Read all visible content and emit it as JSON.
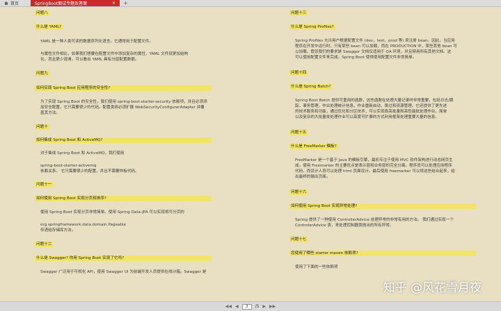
{
  "tabs": {
    "home": "首页",
    "active": "SpringBoot面试专题及答案",
    "close": "×",
    "add": "+"
  },
  "left": {
    "h8": "问题八",
    "q8": "什么是 YAML?",
    "p8a_1": "YAML 是一种人类可读的数据序列化语言。它通常用于配置文件。",
    "p8b_1": "与属性文件相比，如果我们想要在配置文件中添加复杂的属性，YAML 文件就更加结构",
    "p8b_2": "化，而且更少混淆。可以看出 YAML 具有分层配置数据。",
    "h9": "问题九",
    "q9": "如何实现 Spring Boot 应用程序的安全性?",
    "p9_1": "为了实现 Spring Boot 的安全性，我们使用 spring-boot-starter-security 依赖项，并且必须添",
    "p9_2": "加安全配置。它只需要很少的代码。配置类将必须扩展 WebSecurityConfigurerAdapter 并覆",
    "p9_3": "盖其方法。",
    "h10": "问题十",
    "q10": "如何集成 Spring Boot 和 ActiveMQ?",
    "p10a": "对于集成 Spring Boot 和 ActiveMQ，我们使用",
    "p10b": "spring-boot-starter-activemq",
    "p10c": "依赖关系。 它只需要很少的配置，并且不需要样板代码。",
    "h11": "问题十一",
    "q11": "如何使用 Spring Boot 实现分页和排序?",
    "p11a": "使用 Spring Boot 实现分页非常简单。使用 Spring Data-JPA 可以实现将可分页的",
    "p11b": "org.springframework.data.domain.Pageable",
    "p11c": "传递给存储库方法。",
    "h12": "问题十二",
    "q12": "什么是 Swagger? 你用 Spring Boot 实现了它吗?",
    "p12": "Swagger 广泛用于可视化 API，使用 Swagger UI 为前端开发人员提供在线沙箱。Swagger 是"
  },
  "right": {
    "h13": "问题十三",
    "q13": "什么是 Spring Profiles?",
    "p13_1": "Spring Profiles 允许用户根据配置文件 (dev，test，prod 等) 来注册 bean。因此，当应用",
    "p13_2": "程序在开发中运行时，只有某些 bean 可以加载，而在 PRODUCTION 中，某些其他 bean 可",
    "p13_3": "以加载。假设我们的要求是 Swagger 文档仅适用于 QA 环境，并且禁用所有其他文档。这",
    "p13_4": "可以使用配置文件来完成。Spring Boot 使得使用配置文件非常简单。",
    "h14": "问题十四",
    "q14": "什么是 Spring Batch?",
    "p14_1": "Spring Boot Batch 提供可重用的函数，这些函数在处理大量记录时非常重要，包括日志/跟",
    "p14_2": "踪，事务管理，作业处理统计信息，作业重新启动，跳过和资源管理。它还提供了更先进",
    "p14_3": "的技术服务和功能，通过优化和分区技术，可以实现极高批量和高性能批处理作业。简单",
    "p14_4": "以及复杂的大批量批处理作业可以高度可扩展的方式利用框架处理重要大量的信息。",
    "h15": "问题十五",
    "q15": "什么是 FreeMarker 模板?",
    "p15_1": "FreeMarker 是一个基于 Java 的模板引擎，最初专注于使用 MVC 软件架构进行动态网页生",
    "p15_2": "成。使用 Freemarker 的主要优点是表示层和业务层的完全分离。程序员可以处理应用程序",
    "p15_3": "代码，而设计人员可以处理 html 页面设计。最后使用 freemarker 可以将这些结合起来，给",
    "p15_4": "出最终的输出页面。",
    "h16": "问题十六",
    "q16": "如何使用 Spring Boot 实现异常处理?",
    "p16_1": "Spring 提供了一种使用 ControllerAdvice 处理异常的非常有用的方法。 我们通过实现一个",
    "p16_2": "ControlerAdvice 类，来处理控制器类抛出的所有异常。",
    "h17": "问题十七",
    "q17": "您使用了哪些 starter maven 依赖项?",
    "p17": "使用了下面的一些依赖项"
  },
  "toolbar": {
    "page_current": "3",
    "page_total": "/5"
  },
  "watermark": "知乎 @风花雪月夜"
}
